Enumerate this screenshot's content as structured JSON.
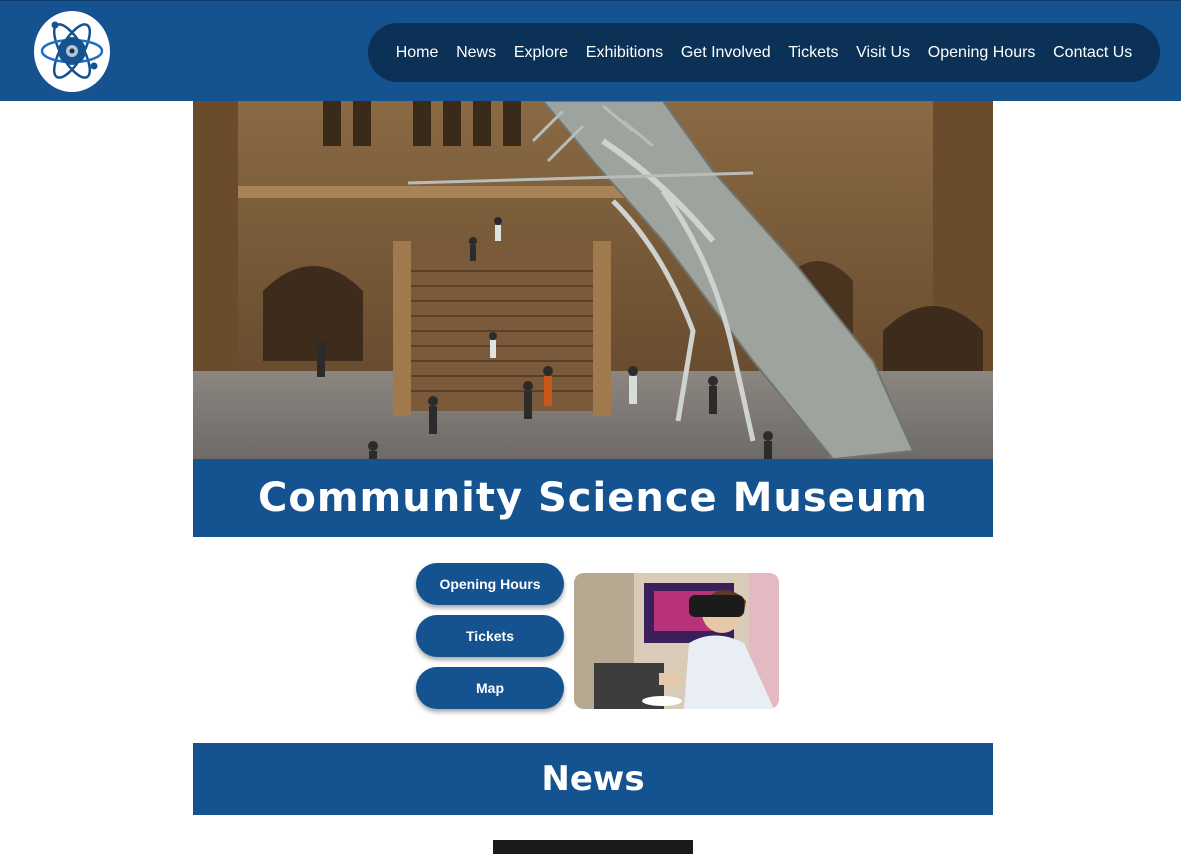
{
  "nav": {
    "items": [
      {
        "label": "Home",
        "name": "nav-home"
      },
      {
        "label": "News",
        "name": "nav-news"
      },
      {
        "label": "Explore",
        "name": "nav-explore"
      },
      {
        "label": "Exhibitions",
        "name": "nav-exhibitions"
      },
      {
        "label": "Get Involved",
        "name": "nav-get-involved"
      },
      {
        "label": "Tickets",
        "name": "nav-tickets"
      },
      {
        "label": "Visit Us",
        "name": "nav-visit-us"
      },
      {
        "label": "Opening Hours",
        "name": "nav-opening-hours"
      },
      {
        "label": "Contact Us",
        "name": "nav-contact-us"
      }
    ]
  },
  "hero": {
    "title": "Community Science Museum"
  },
  "quick_links": {
    "opening_hours": "Opening Hours",
    "tickets": "Tickets",
    "map": "Map"
  },
  "news": {
    "heading": "News"
  },
  "colors": {
    "brand_blue": "#145290",
    "nav_pill": "#0b3256",
    "text_on_brand": "#ffffff"
  },
  "icons": {
    "logo": "atom-logo-icon"
  }
}
